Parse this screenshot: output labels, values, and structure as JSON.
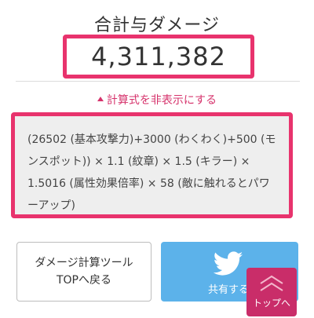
{
  "header": {
    "title": "合計与ダメージ",
    "total_damage": "4,311,382"
  },
  "toggle": {
    "label": "計算式を非表示にする"
  },
  "formula": {
    "text": "(26502 (基本攻撃力)+3000 (わくわく)+500 (モンスポット)) × 1.1 (紋章) × 1.5 (キラー) × 1.5016 (属性効果倍率) × 58 (敵に触れるとパワーアップ)"
  },
  "buttons": {
    "back_line1": "ダメージ計算ツール",
    "back_line2": "TOPへ戻る",
    "share_label": "共有する",
    "top_label": "トップへ"
  },
  "colors": {
    "accent": "#e8336d",
    "twitter": "#5cb2ea",
    "top_button": "#c92d69"
  }
}
